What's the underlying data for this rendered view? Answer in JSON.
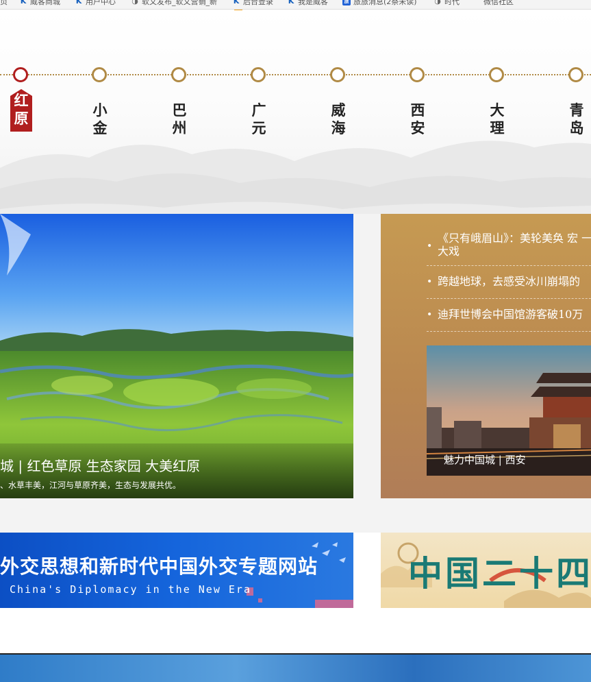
{
  "bookmarks": [
    {
      "label": "页",
      "icon": "none"
    },
    {
      "label": "威客商城",
      "icon": "k-logo-icon"
    },
    {
      "label": "用户中心",
      "icon": "k-logo-icon"
    },
    {
      "label": "软文发布_软文营销_新",
      "icon": "globe-icon"
    },
    {
      "label": "后台登录",
      "icon": "k-logo-icon"
    },
    {
      "label": "我是威客",
      "icon": "k-logo-icon"
    },
    {
      "label": "旅旅消息(2祭未读)",
      "icon": "blue-square-icon",
      "icon_text": "旅"
    },
    {
      "label": "时代",
      "icon": "globe-icon"
    },
    {
      "label": "微信社区",
      "icon": "none"
    }
  ],
  "timeline": {
    "active_index": 0,
    "cities": [
      {
        "char1": "红",
        "char2": "原"
      },
      {
        "char1": "小",
        "char2": "金"
      },
      {
        "char1": "巴",
        "char2": "州"
      },
      {
        "char1": "广",
        "char2": "元"
      },
      {
        "char1": "威",
        "char2": "海"
      },
      {
        "char1": "西",
        "char2": "安"
      },
      {
        "char1": "大",
        "char2": "理"
      },
      {
        "char1": "青",
        "char2": "岛"
      }
    ]
  },
  "feature": {
    "title": "城 | 红色草原 生态家园 大美红原",
    "desc": "、水草丰美，江河与草原齐美，生态与发展共优。"
  },
  "news": {
    "items": [
      {
        "text": "《只有峨眉山》：美轮美奂 宏 一场大戏"
      },
      {
        "text": "跨越地球，去感受冰川崩塌的"
      },
      {
        "text": "迪拜世博会中国馆游客破10万"
      }
    ],
    "thumb_caption": "魅力中国城 | 西安"
  },
  "banners": {
    "left_title": "外交思想和新时代中国外交专题网站",
    "left_subtitle": "China's Diplomacy in the New Era",
    "right_title": "中国二十四"
  },
  "colors": {
    "accent_red": "#b01e1e",
    "timeline_gold": "#b08a45",
    "news_gold": "#c69a52"
  }
}
